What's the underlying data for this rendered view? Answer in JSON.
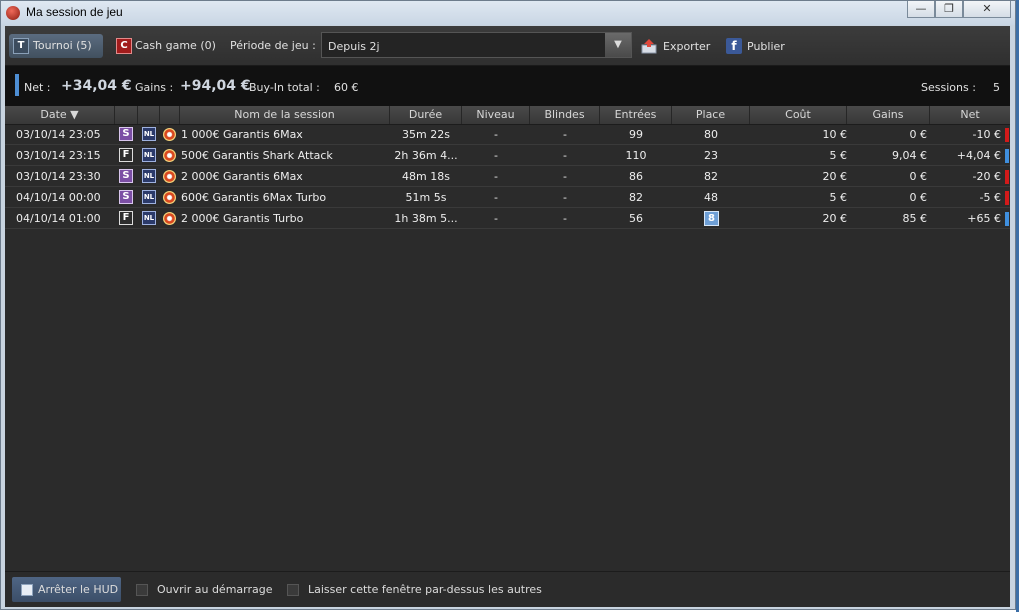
{
  "window": {
    "title": "Ma session de jeu",
    "minimize_label": "—",
    "restore_label": "❐",
    "close_label": "✕"
  },
  "toolbar": {
    "tournoi_letter": "T",
    "tournoi_label": "Tournoi (5)",
    "cash_letter": "C",
    "cash_label": "Cash game (0)",
    "period_label": "Période de jeu :",
    "period_value": "Depuis 2j",
    "export_label": "Exporter",
    "publish_label": "Publier"
  },
  "summary": {
    "net_label": "Net :",
    "net_value": "+34,04 €",
    "gains_label": "Gains :",
    "gains_value": "+94,04 €",
    "buyin_label": "Buy-In total :",
    "buyin_value": "60 €",
    "sessions_label": "Sessions :",
    "sessions_value": "5"
  },
  "table": {
    "columns": [
      "Date ▼",
      "Nom de la session",
      "Durée",
      "Niveau",
      "Blindes",
      "Entrées",
      "Place",
      "Coût",
      "Gains",
      "Net"
    ],
    "rows": [
      {
        "date": "03/10/14 23:05",
        "type": "S",
        "limit": "NL",
        "name": "1 000€ Garantis 6Max",
        "duration": "35m 22s",
        "level": "-",
        "blinds": "-",
        "entries": "99",
        "place": "80",
        "cost": "10 €",
        "gains": "0 €",
        "net": "-10 €",
        "net_color": "#d21a1a"
      },
      {
        "date": "03/10/14 23:15",
        "type": "F",
        "limit": "NL",
        "name": "500€ Garantis Shark Attack",
        "duration": "2h 36m 4...",
        "level": "-",
        "blinds": "-",
        "entries": "110",
        "place": "23",
        "cost": "5 €",
        "gains": "9,04 €",
        "net": "+4,04 €",
        "net_color": "#3f8fde"
      },
      {
        "date": "03/10/14 23:30",
        "type": "S",
        "limit": "NL",
        "name": "2 000€ Garantis 6Max",
        "duration": "48m 18s",
        "level": "-",
        "blinds": "-",
        "entries": "86",
        "place": "82",
        "cost": "20 €",
        "gains": "0 €",
        "net": "-20 €",
        "net_color": "#d21a1a"
      },
      {
        "date": "04/10/14 00:00",
        "type": "S",
        "limit": "NL",
        "name": "600€ Garantis 6Max Turbo",
        "duration": "51m 5s",
        "level": "-",
        "blinds": "-",
        "entries": "82",
        "place": "48",
        "cost": "5 €",
        "gains": "0 €",
        "net": "-5 €",
        "net_color": "#d21a1a"
      },
      {
        "date": "04/10/14 01:00",
        "type": "F",
        "limit": "NL",
        "name": "2 000€ Garantis Turbo",
        "duration": "1h 38m 5...",
        "level": "-",
        "blinds": "-",
        "entries": "56",
        "place": "8",
        "cost": "20 €",
        "gains": "85 €",
        "net": "+65 €",
        "net_color": "#3f8fde"
      }
    ]
  },
  "footer": {
    "stop_hud_label": "Arrêter le HUD",
    "open_at_startup_label": "Ouvrir au démarrage",
    "keep_on_top_label": "Laisser cette fenêtre par-dessus les autres"
  },
  "colors": {
    "accent": "#4d8ed4",
    "positive": "#3f8fde",
    "negative": "#d21a1a",
    "panel": "#2b2b2b"
  }
}
